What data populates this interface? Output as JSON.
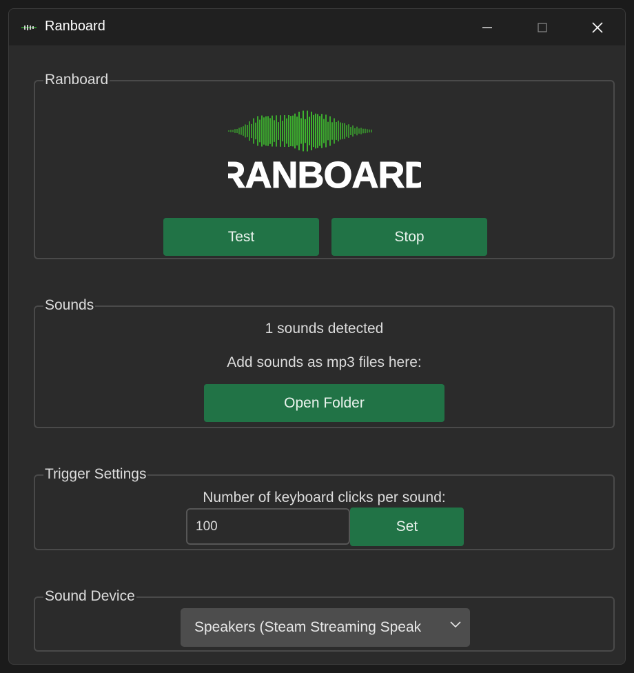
{
  "window": {
    "title": "Ranboard",
    "icon": "ranboard-waveform-icon",
    "controls": [
      "minimize-icon",
      "maximize-icon",
      "close-icon"
    ]
  },
  "ranboard": {
    "group_label": "Ranboard",
    "logo_text": "RANBOARD",
    "logo_color": "#3fbf2f",
    "test_label": "Test",
    "stop_label": "Stop"
  },
  "sounds": {
    "group_label": "Sounds",
    "detected_text": "1 sounds detected",
    "hint_text": "Add sounds as mp3 files here:",
    "open_folder_label": "Open Folder"
  },
  "trigger": {
    "group_label": "Trigger Settings",
    "prompt_text": "Number of keyboard clicks per sound:",
    "input_value": "100",
    "set_label": "Set"
  },
  "device": {
    "group_label": "Sound Device",
    "selected_value": "Speakers (Steam Streaming Speak",
    "chevron_icon": "chevron-down-icon"
  },
  "colors": {
    "accent_button": "#217346",
    "window_bg": "#2b2b2b",
    "titlebar_bg": "#202020"
  }
}
